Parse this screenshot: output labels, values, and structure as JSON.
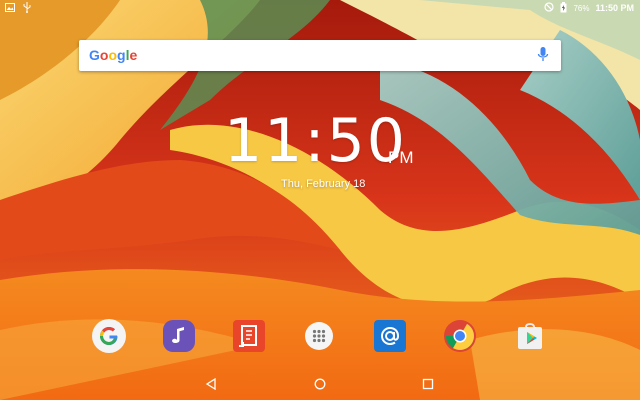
{
  "wallpaper": {
    "colors": {
      "deep": "#c0200f",
      "orange": "#f0781c",
      "yellow": "#f7c844",
      "teal": "#7fb7b0",
      "cream": "#f5e3a6"
    }
  },
  "status_bar": {
    "left_icons": [
      "image-icon",
      "usb-icon"
    ],
    "right_icons": [
      "do-not-disturb-icon",
      "battery-charging-icon"
    ],
    "battery": "76%",
    "time": "11:50 PM"
  },
  "search": {
    "logo_text": "Google",
    "logo_colors": [
      "#4285f4",
      "#ea4335",
      "#fbbc05",
      "#4285f4",
      "#34a853",
      "#ea4335"
    ],
    "icon": "mic-icon"
  },
  "clock": {
    "time": "11:50",
    "ampm": "PM",
    "date": "Thu, February 18"
  },
  "dock": {
    "apps": [
      {
        "name": "google-app-icon"
      },
      {
        "name": "music-app-icon"
      },
      {
        "name": "documents-app-icon"
      },
      {
        "name": "app-drawer-icon"
      },
      {
        "name": "email-app-icon"
      },
      {
        "name": "chrome-app-icon"
      },
      {
        "name": "play-store-app-icon"
      }
    ]
  },
  "nav": {
    "icons": [
      "back-icon",
      "home-icon",
      "recents-icon"
    ]
  }
}
